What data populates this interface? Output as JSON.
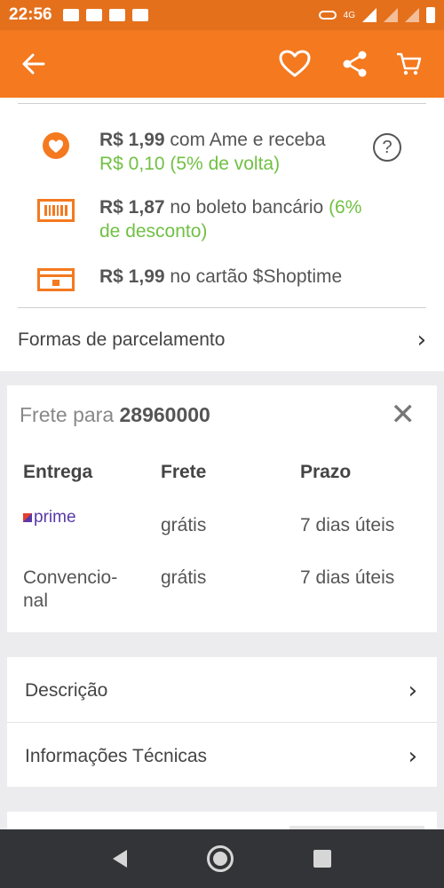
{
  "status_bar": {
    "time": "22:56",
    "network": "4G"
  },
  "payments": {
    "ame": {
      "price": "R$ 1,99",
      "text": "com Ame e receba",
      "cashback": "R$ 0,10 (5% de volta)"
    },
    "boleto": {
      "price": "R$ 1,87",
      "text": "no boleto bancário",
      "discount_open": "(6%",
      "discount_close": "de desconto)"
    },
    "card": {
      "price": "R$ 1,99",
      "text": "no cartão $Shoptime"
    },
    "help_symbol": "?"
  },
  "installments": {
    "label": "Formas de parcelamento"
  },
  "shipping": {
    "title_prefix": "Frete para",
    "cep": "28960000",
    "close_symbol": "✕",
    "headers": {
      "delivery": "Entrega",
      "freight": "Frete",
      "deadline": "Prazo"
    },
    "rows": [
      {
        "delivery": "prime",
        "freight": "grátis",
        "deadline": "7 dias úteis"
      },
      {
        "delivery_line1": "Convencio-",
        "delivery_line2": "nal",
        "freight": "grátis",
        "deadline": "7 dias úteis"
      }
    ]
  },
  "links": {
    "description": "Descrição",
    "technical": "Informações Técnicas"
  },
  "chevron": "›",
  "colors": {
    "brand_orange": "#f4791f",
    "status_orange": "#e4701c",
    "green": "#71c044",
    "prime_purple": "#5a39a8"
  }
}
